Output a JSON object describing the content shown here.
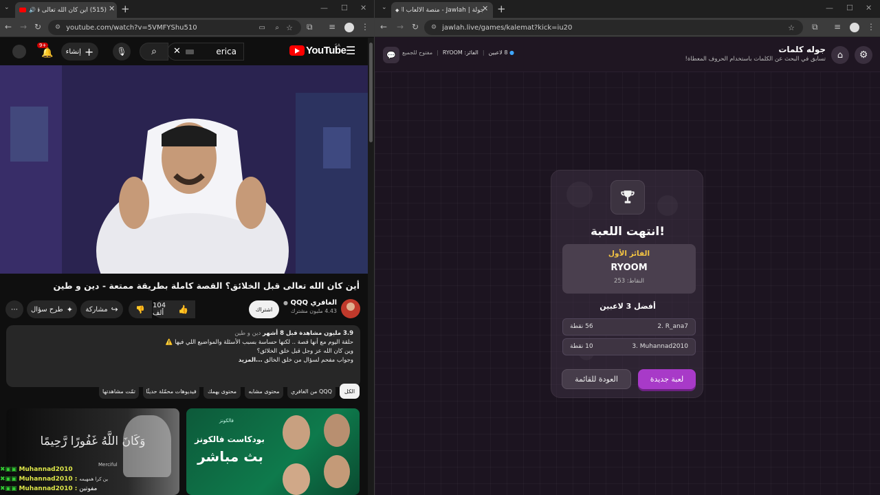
{
  "left_browser": {
    "tab": {
      "title": "(515) أين كان الله تعالى قبل ا..."
    },
    "url": "youtube.com/watch?v=5VMFYShu510",
    "youtube": {
      "logo": "YouTube",
      "country": "SA",
      "search_value": "erica",
      "create_label": "إنشاء",
      "notif_badge": "9+",
      "video_title": "أين كان الله تعالى قبل الخلائق؟ القصة كاملة بطريقة ممتعة - دين و طين",
      "channel_name": "الغافري QQQ",
      "subscribers": "4.43 مليون مشترك",
      "subscribe_label": "اشتراك",
      "likes": "104 ألف",
      "share_label": "مشاركة",
      "ask_label": "طرح سؤال",
      "description": {
        "stats_views": "3.9 مليون مشاهدة",
        "stats_time": "قبل 8 أشهر",
        "tags": "دين و طين",
        "line1": "حلقة اليوم مع أنها قصة .. لكنها حساسة بسبب الأسئلة والمواضيع اللي فيها ⚠️",
        "line2": "وين كان الله عز وجل قبل خلق الخلائق؟",
        "line3": "وجواب مفحم لسؤال من خلق الخالق",
        "more": "...المزيد"
      },
      "chips": [
        "الكل",
        "من الغافري QQQ",
        "محتوى مشابه",
        "محتوى يهمك",
        "فيديوهات محمّلة حديثًا",
        "تمّت مشاهدتها"
      ],
      "thumb1_text": "وَكَانَ اللَّهُ غَفُورًا رَّحِيمًا",
      "thumb1_sub": "Merciful",
      "thumb2_brand": "فالكونز",
      "thumb2_title": "بودكاست فالكونز",
      "thumb2_live": "بث مباشر",
      "chat": [
        {
          "user": "Muhannad2010",
          "msg": ""
        },
        {
          "user": "Muhannad2010 :",
          "msg": "ين كرا همهيمه"
        },
        {
          "user": "Muhannad2010 :",
          "msg": "مفوتين"
        }
      ]
    }
  },
  "right_browser": {
    "tab": {
      "title": "جولة | Jawlah - منصة الألعاب الت..."
    },
    "url": "jawlah.live/games/kalemat?kick=iu20",
    "jawlah": {
      "game_title": "جوله كلمات",
      "game_subtitle": "تسابق في البحث عن الكلمات باستخدام الحروف المعطاة!",
      "players": "8 لاعبين",
      "winner_label": "الفائز:",
      "winner_name": "RYOOM",
      "open_status": "مفتوح للجميع",
      "result": {
        "heading": "انتهت اللعبة!",
        "first_label": "الفائز الأول",
        "first_name": "RYOOM",
        "first_points": "النقاط: 253",
        "top_heading": "أفضل 3 لاعبين",
        "rows": [
          {
            "rank_name": "2. R_ana7",
            "points": "56 نقطة"
          },
          {
            "rank_name": "3. Muhannad2010",
            "points": "10 نقطة"
          }
        ],
        "new_game": "لعبة جديدة",
        "back": "العودة للقائمة"
      }
    }
  },
  "colors": {
    "yt_red": "#ff0000",
    "jw_accent": "#a83ac8",
    "winner_gold": "#f5c542",
    "status_blue": "#3ea6ff"
  }
}
